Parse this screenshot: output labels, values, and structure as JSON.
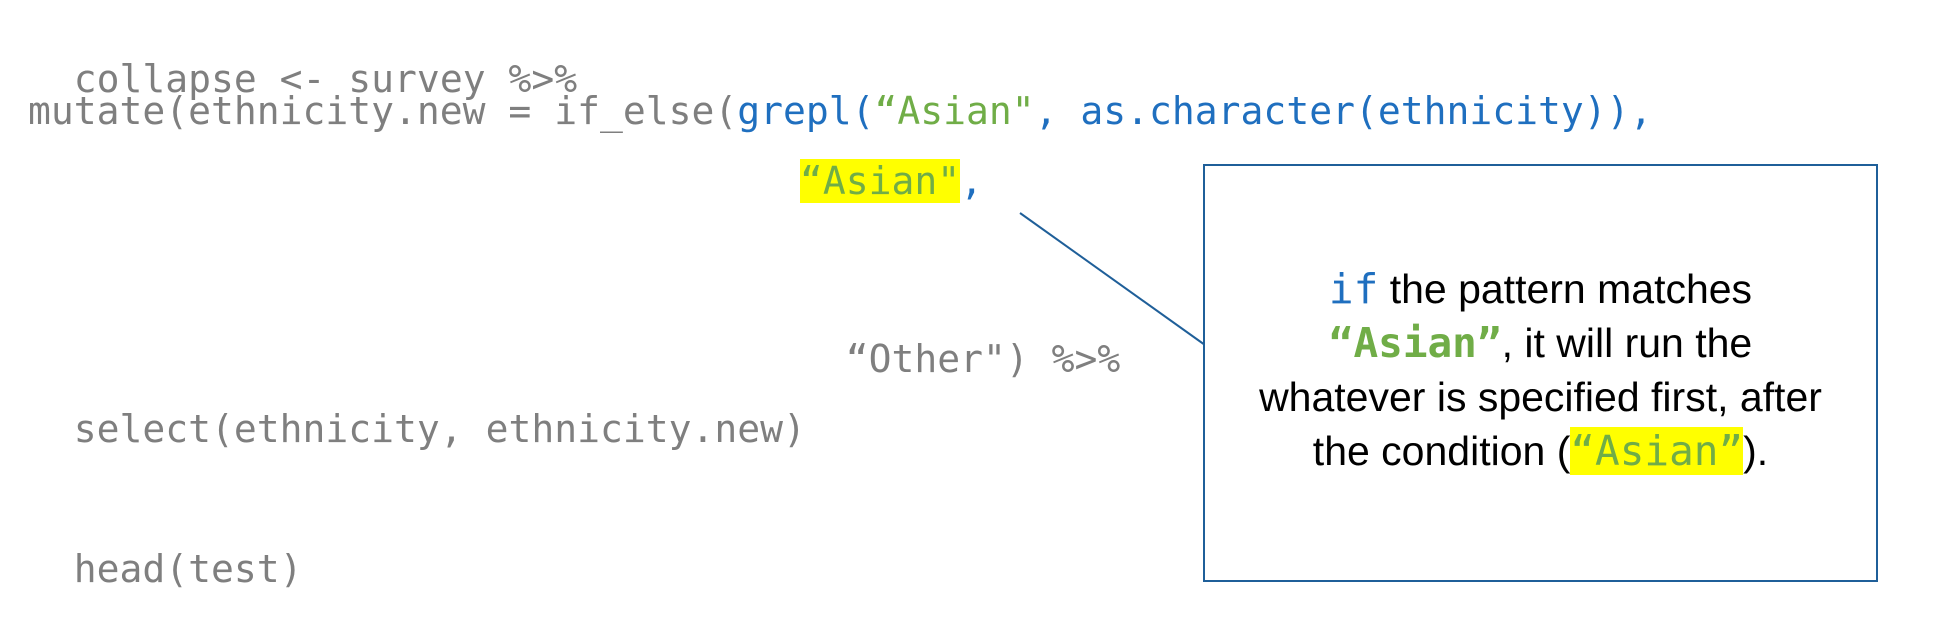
{
  "code": {
    "line1": "collapse <- survey %>%",
    "line2": {
      "prefix": "mutate(ethnicity.new = if_else(",
      "fn": "grepl(",
      "str": "“Asian\"",
      "mid": ", as.character(ethnicity)),"
    },
    "line3": {
      "str": "“Asian\"",
      "comma": ","
    },
    "line4": "“Other\") %>%",
    "line5": "select(ethnicity, ethnicity.new)",
    "line6": "head(test)"
  },
  "callout": {
    "keyword": "if",
    "text1": " the pattern matches",
    "match": "“Asian”",
    "text2": ", it will run the",
    "text3": "whatever is specified first, after",
    "text4": "the condition (",
    "value": "“Asian”",
    "text5": ")."
  },
  "colors": {
    "code_gray": "#7f7f7f",
    "code_blue": "#1f6fbf",
    "string_green": "#70ad47",
    "highlight": "#ffff00",
    "callout_border": "#1f5f99"
  }
}
